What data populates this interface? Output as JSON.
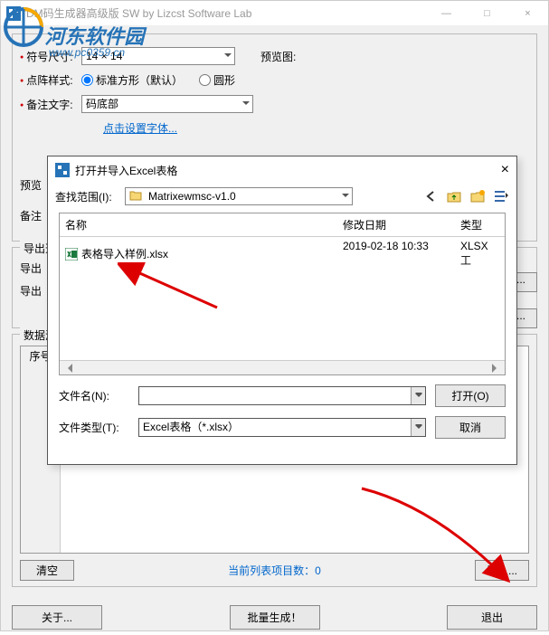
{
  "window": {
    "title": "DM码生成器高级版 SW  by Lizcst Software Lab",
    "minimize": "—",
    "maximize": "□",
    "close": "×"
  },
  "logo": {
    "name": "河东软件园",
    "url": "www.pc0359.cn"
  },
  "main": {
    "symbol_size_label": "符号尺寸:",
    "symbol_size_value": "14 × 14",
    "preview_label": "预览图:",
    "pattern_label": "点阵样式:",
    "pattern_option1": "标准方形（默认）",
    "pattern_option2": "圆形",
    "note_label": "备注文字:",
    "note_value": "码底部",
    "font_link": "点击设置字体...",
    "preview2_label": "预览",
    "note2_label": "备注"
  },
  "export_section": {
    "title": "导出选",
    "row1": "导出",
    "row2": "导出"
  },
  "data_section": {
    "title": "数据源",
    "col_header": "序号",
    "clear_btn": "清空",
    "import_btn": "导入...",
    "list_status": "当前列表项目数：0"
  },
  "footer": {
    "about": "关于...",
    "batch": "批量生成！",
    "exit": "退出"
  },
  "file_dialog": {
    "title": "打开并导入Excel表格",
    "look_in_label": "查找范围(I):",
    "look_in_value": "Matrixewmsc-v1.0",
    "col_name": "名称",
    "col_date": "修改日期",
    "col_type": "类型",
    "rows": [
      {
        "name": "表格导入样例.xlsx",
        "date": "2019-02-18 10:33",
        "type": "XLSX 工"
      }
    ],
    "filename_label": "文件名(N):",
    "filename_value": "",
    "filetype_label": "文件类型(T):",
    "filetype_value": "Excel表格（*.xlsx）",
    "open_btn": "打开(O)",
    "cancel_btn": "取消"
  }
}
